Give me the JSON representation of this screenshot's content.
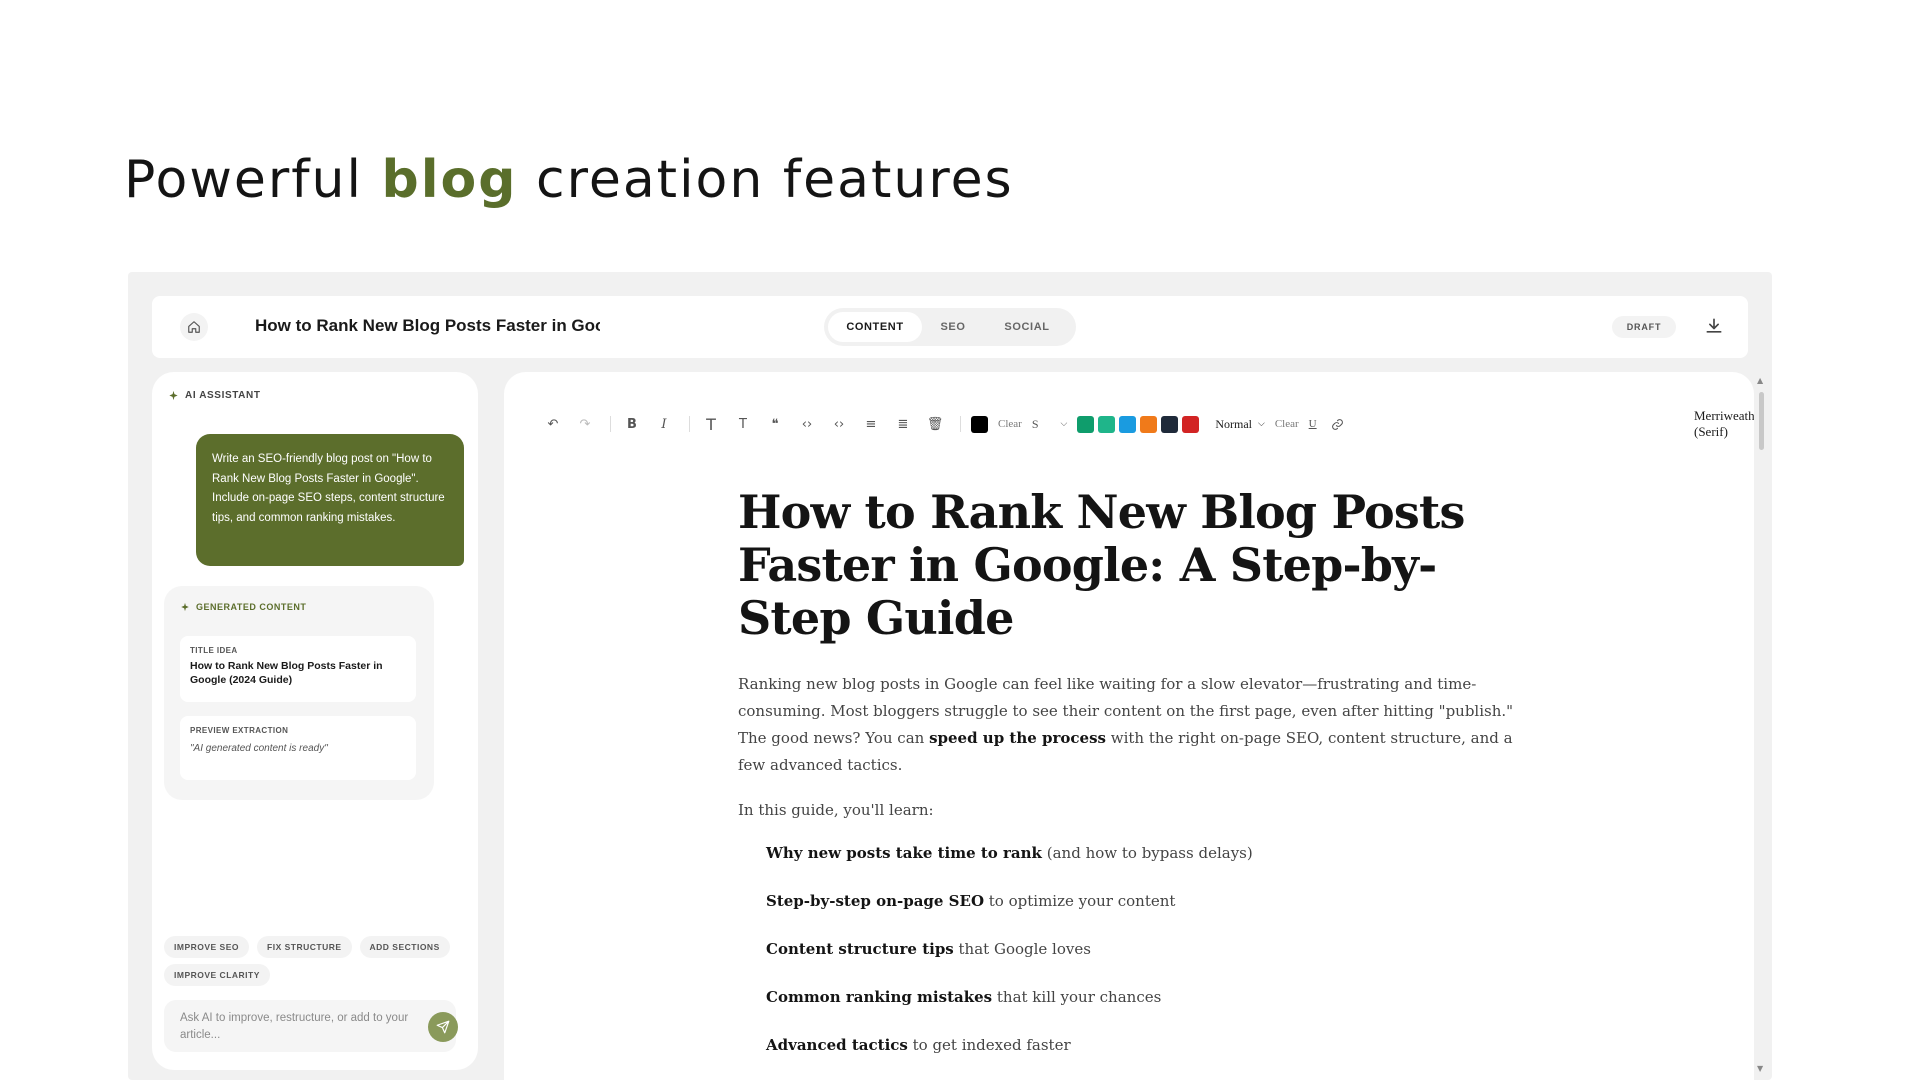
{
  "hero": {
    "prefix": "Powerful ",
    "accent": "blog",
    "suffix": " creation features"
  },
  "header": {
    "doc_title": "How to Rank New Blog Posts Faster in Google",
    "tabs": [
      "CONTENT",
      "SEO",
      "SOCIAL"
    ],
    "active_tab": "CONTENT",
    "status_badge": "DRAFT"
  },
  "assistant": {
    "label": "AI ASSISTANT",
    "prompt": "Write an SEO-friendly blog post on \"How to Rank New Blog Posts Faster in Google\". Include on-page SEO steps, content structure tips, and common ranking mistakes.",
    "generated": {
      "label": "GENERATED CONTENT",
      "title_idea_label": "TITLE IDEA",
      "title_idea": "How to Rank New Blog Posts Faster in Google (2024 Guide)",
      "preview_label": "PREVIEW EXTRACTION",
      "preview_text": "\"AI generated content is ready\""
    },
    "chips": [
      "IMPROVE SEO",
      "FIX STRUCTURE",
      "ADD SECTIONS",
      "IMPROVE CLARITY"
    ],
    "input_placeholder": "Ask AI to improve, restructure, or add to your article..."
  },
  "toolbar": {
    "clear_label": "Clear",
    "size_label": "S",
    "style_label": "Normal",
    "clear_label_2": "Clear",
    "underline_label": "U",
    "font_family": "Merriweather (Serif)",
    "swatches": [
      "#0f9d6c",
      "#1fb58a",
      "#1a9be0",
      "#f07a1a",
      "#1f2a3a",
      "#d22424"
    ]
  },
  "article": {
    "title": "How to Rank New Blog Posts Faster in Google: A Step-by-Step Guide",
    "intro_before_bold": "Ranking new blog posts in Google can feel like waiting for a slow elevator—frustrating and time-consuming. Most bloggers struggle to see their content on the first page, even after hitting \"publish.\" The good news? You can ",
    "intro_bold": "speed up the process",
    "intro_after_bold": " with the right on-page SEO, content structure, and a few advanced tactics.",
    "learn_intro": "In this guide, you'll learn:",
    "bullets": [
      {
        "bold": "Why new posts take time to rank",
        "rest": " (and how to bypass delays)"
      },
      {
        "bold": "Step-by-step on-page SEO",
        "rest": " to optimize your content"
      },
      {
        "bold": "Content structure tips",
        "rest": " that Google loves"
      },
      {
        "bold": "Common ranking mistakes",
        "rest": " that kill your chances"
      },
      {
        "bold": "Advanced tactics",
        "rest": " to get indexed faster"
      }
    ]
  }
}
